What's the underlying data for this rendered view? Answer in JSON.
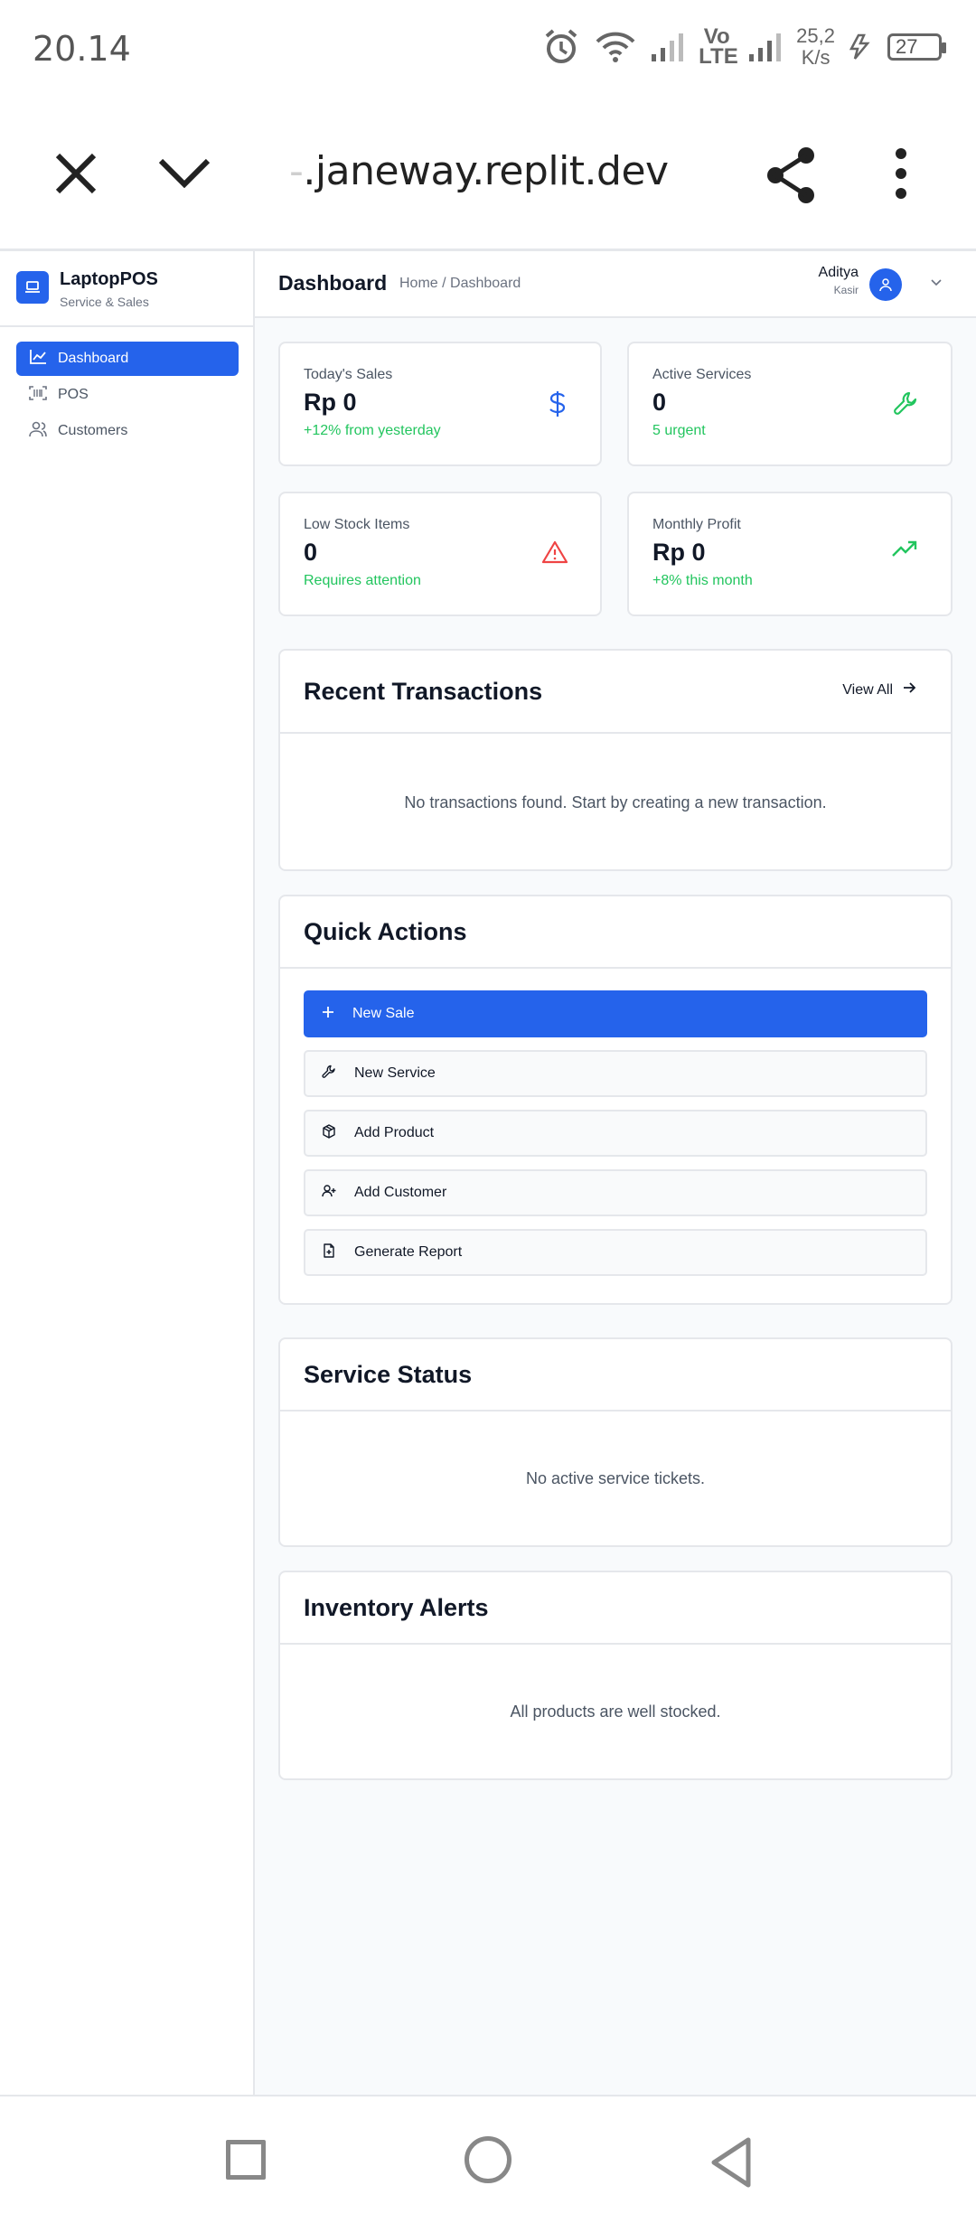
{
  "status_bar": {
    "time": "20.14",
    "network": "Vo LTE",
    "speed_value": "25,2",
    "speed_unit": "K/s",
    "battery": "27",
    "icon_color": "#666666"
  },
  "browser": {
    "url_hidden_prefix": "-",
    "url": ".janeway.replit.dev",
    "icons": [
      "close-icon",
      "chevron-down-icon",
      "share-icon",
      "more-vertical-icon"
    ]
  },
  "sidebar": {
    "brand_name": "LaptopPOS",
    "brand_tagline": "Service & Sales",
    "items": [
      {
        "label": "Dashboard",
        "icon": "chart-line-icon",
        "active": true
      },
      {
        "label": "POS",
        "icon": "scan-barcode-icon",
        "active": false
      },
      {
        "label": "Customers",
        "icon": "users-icon",
        "active": false
      }
    ]
  },
  "header": {
    "title": "Dashboard",
    "breadcrumb": "Home / Dashboard",
    "user_name": "Aditya",
    "user_role": "Kasir"
  },
  "stats": [
    {
      "label": "Today's Sales",
      "value": "Rp 0",
      "note": "+12% from yesterday",
      "icon": "dollar-icon",
      "icon_color": "#2563eb"
    },
    {
      "label": "Active Services",
      "value": "0",
      "note": "5 urgent",
      "icon": "wrench-icon",
      "icon_color": "#22c55e"
    },
    {
      "label": "Low Stock Items",
      "value": "0",
      "note": "Requires attention",
      "icon": "alert-triangle-icon",
      "icon_color": "#ef4444"
    },
    {
      "label": "Monthly Profit",
      "value": "Rp 0",
      "note": "+8% this month",
      "icon": "trending-up-icon",
      "icon_color": "#22c55e"
    }
  ],
  "recent_transactions": {
    "title": "Recent Transactions",
    "view_all": "View All",
    "empty": "No transactions found. Start by creating a new transaction."
  },
  "quick_actions": {
    "title": "Quick Actions",
    "buttons": [
      {
        "label": "New Sale",
        "icon": "plus-icon",
        "primary": true
      },
      {
        "label": "New Service",
        "icon": "wrench-icon",
        "primary": false
      },
      {
        "label": "Add Product",
        "icon": "package-icon",
        "primary": false
      },
      {
        "label": "Add Customer",
        "icon": "user-plus-icon",
        "primary": false
      },
      {
        "label": "Generate Report",
        "icon": "file-report-icon",
        "primary": false
      }
    ]
  },
  "service_status": {
    "title": "Service Status",
    "empty": "No active service tickets."
  },
  "inventory_alerts": {
    "title": "Inventory Alerts",
    "empty": "All products are well stocked."
  },
  "colors": {
    "accent": "#2563eb",
    "success": "#22c55e",
    "danger": "#ef4444",
    "border": "#e5e7eb",
    "page_bg": "#f8fafc"
  }
}
